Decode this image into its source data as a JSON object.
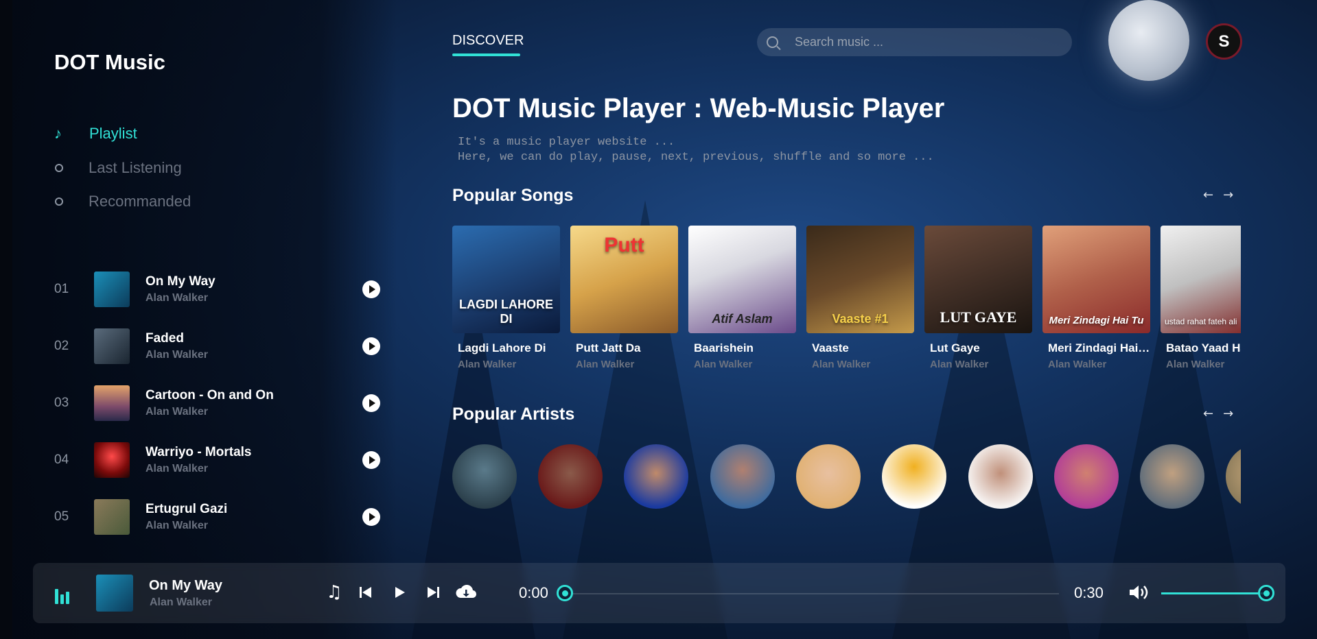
{
  "app": {
    "logo": "DOT Music"
  },
  "nav": [
    {
      "label": "Playlist",
      "active": true,
      "icon": "music-note-icon"
    },
    {
      "label": "Last Listening",
      "active": false,
      "icon": "circle-icon"
    },
    {
      "label": "Recommanded",
      "active": false,
      "icon": "circle-icon"
    }
  ],
  "playlist": [
    {
      "num": "01",
      "title": "On My Way",
      "artist": "Alan Walker"
    },
    {
      "num": "02",
      "title": "Faded",
      "artist": "Alan Walker"
    },
    {
      "num": "03",
      "title": "Cartoon - On and On",
      "artist": "Alan Walker"
    },
    {
      "num": "04",
      "title": "Warriyo - Mortals",
      "artist": "Alan Walker"
    },
    {
      "num": "05",
      "title": "Ertugrul Gazi",
      "artist": "Alan Walker"
    }
  ],
  "header": {
    "tab": "DISCOVER",
    "search_placeholder": "Search music ...",
    "avatar_letter": "S"
  },
  "hero": {
    "title": "DOT Music Player : Web-Music Player",
    "line1": "It's a music player website ...",
    "line2": "Here, we can do play, pause, next, previous, shuffle and so more ..."
  },
  "popular_songs": {
    "title": "Popular Songs",
    "items": [
      {
        "title": "Lagdi Lahore Di",
        "artist": "Alan Walker",
        "cover_text": "LAGDI LAHORE DI"
      },
      {
        "title": "Putt Jatt Da",
        "artist": "Alan Walker",
        "cover_text": "Putt"
      },
      {
        "title": "Baarishein",
        "artist": "Alan Walker",
        "cover_text": "Atif Aslam"
      },
      {
        "title": "Vaaste",
        "artist": "Alan Walker",
        "cover_text": "Vaaste #1"
      },
      {
        "title": "Lut Gaye",
        "artist": "Alan Walker",
        "cover_text": "LUT GAYE"
      },
      {
        "title": "Meri Zindagi Hai Tu",
        "artist": "Alan Walker",
        "cover_text": "Meri Zindagi Hai Tu"
      },
      {
        "title": "Batao Yaad Hai",
        "artist": "Alan Walker",
        "cover_text": "ustad rahat fateh ali"
      }
    ]
  },
  "popular_artists": {
    "title": "Popular Artists",
    "count": 10
  },
  "player": {
    "title": "On My Way",
    "artist": "Alan Walker",
    "current_time": "0:00",
    "duration": "0:30",
    "progress": 0,
    "volume": 1.0
  },
  "colors": {
    "accent": "#31e1d6",
    "muted": "#6b7280"
  }
}
